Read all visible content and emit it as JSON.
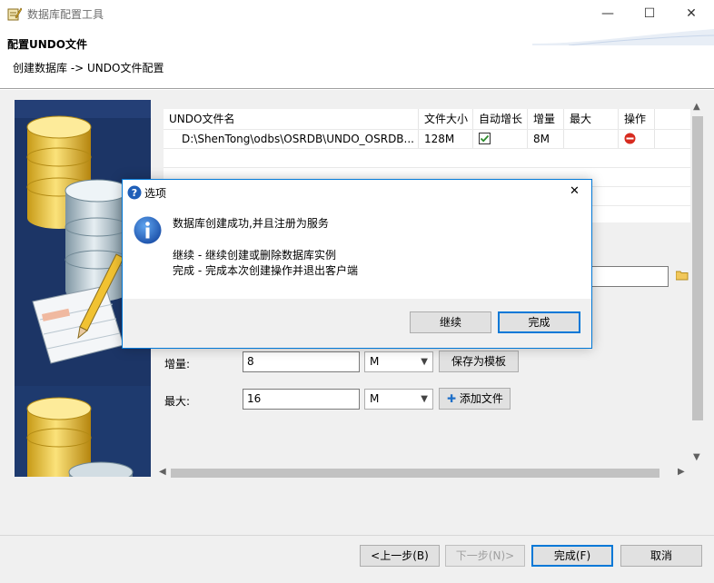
{
  "window": {
    "title": "数据库配置工具",
    "minimize": "—",
    "maximize": "☐",
    "close": "✕"
  },
  "header": {
    "title": "配置UNDO文件",
    "breadcrumb": "创建数据库 -> UNDO文件配置"
  },
  "table": {
    "columns": [
      "UNDO文件名",
      "文件大小",
      "自动增长",
      "增量",
      "最大",
      "操作"
    ],
    "rows": [
      {
        "name": "D:\\ShenTong\\odbs\\OSRDB\\UNDO_OSRDB...",
        "size": "128M",
        "auto_grow": true,
        "increment": "8M",
        "max": "",
        "action_icon": "delete-icon"
      }
    ]
  },
  "form": {
    "increment_label": "增量:",
    "increment_value": "8",
    "increment_unit": "M",
    "max_label": "最大:",
    "max_value": "16",
    "max_unit": "M",
    "save_template_label": "保存为模板",
    "add_file_label": "添加文件"
  },
  "footer": {
    "prev_label": "<上一步(B)",
    "next_label": "下一步(N)>",
    "finish_label": "完成(F)",
    "cancel_label": "取消"
  },
  "dialog": {
    "title": "选项",
    "message_line1": "数据库创建成功,并且注册为服务",
    "message_line2": "继续 - 继续创建或删除数据库实例",
    "message_line3": "完成 - 完成本次创建操作并退出客户端",
    "continue_label": "继续",
    "finish_label": "完成",
    "close": "✕"
  },
  "colors": {
    "accent": "#0078d7",
    "banner": "#1c3566"
  }
}
